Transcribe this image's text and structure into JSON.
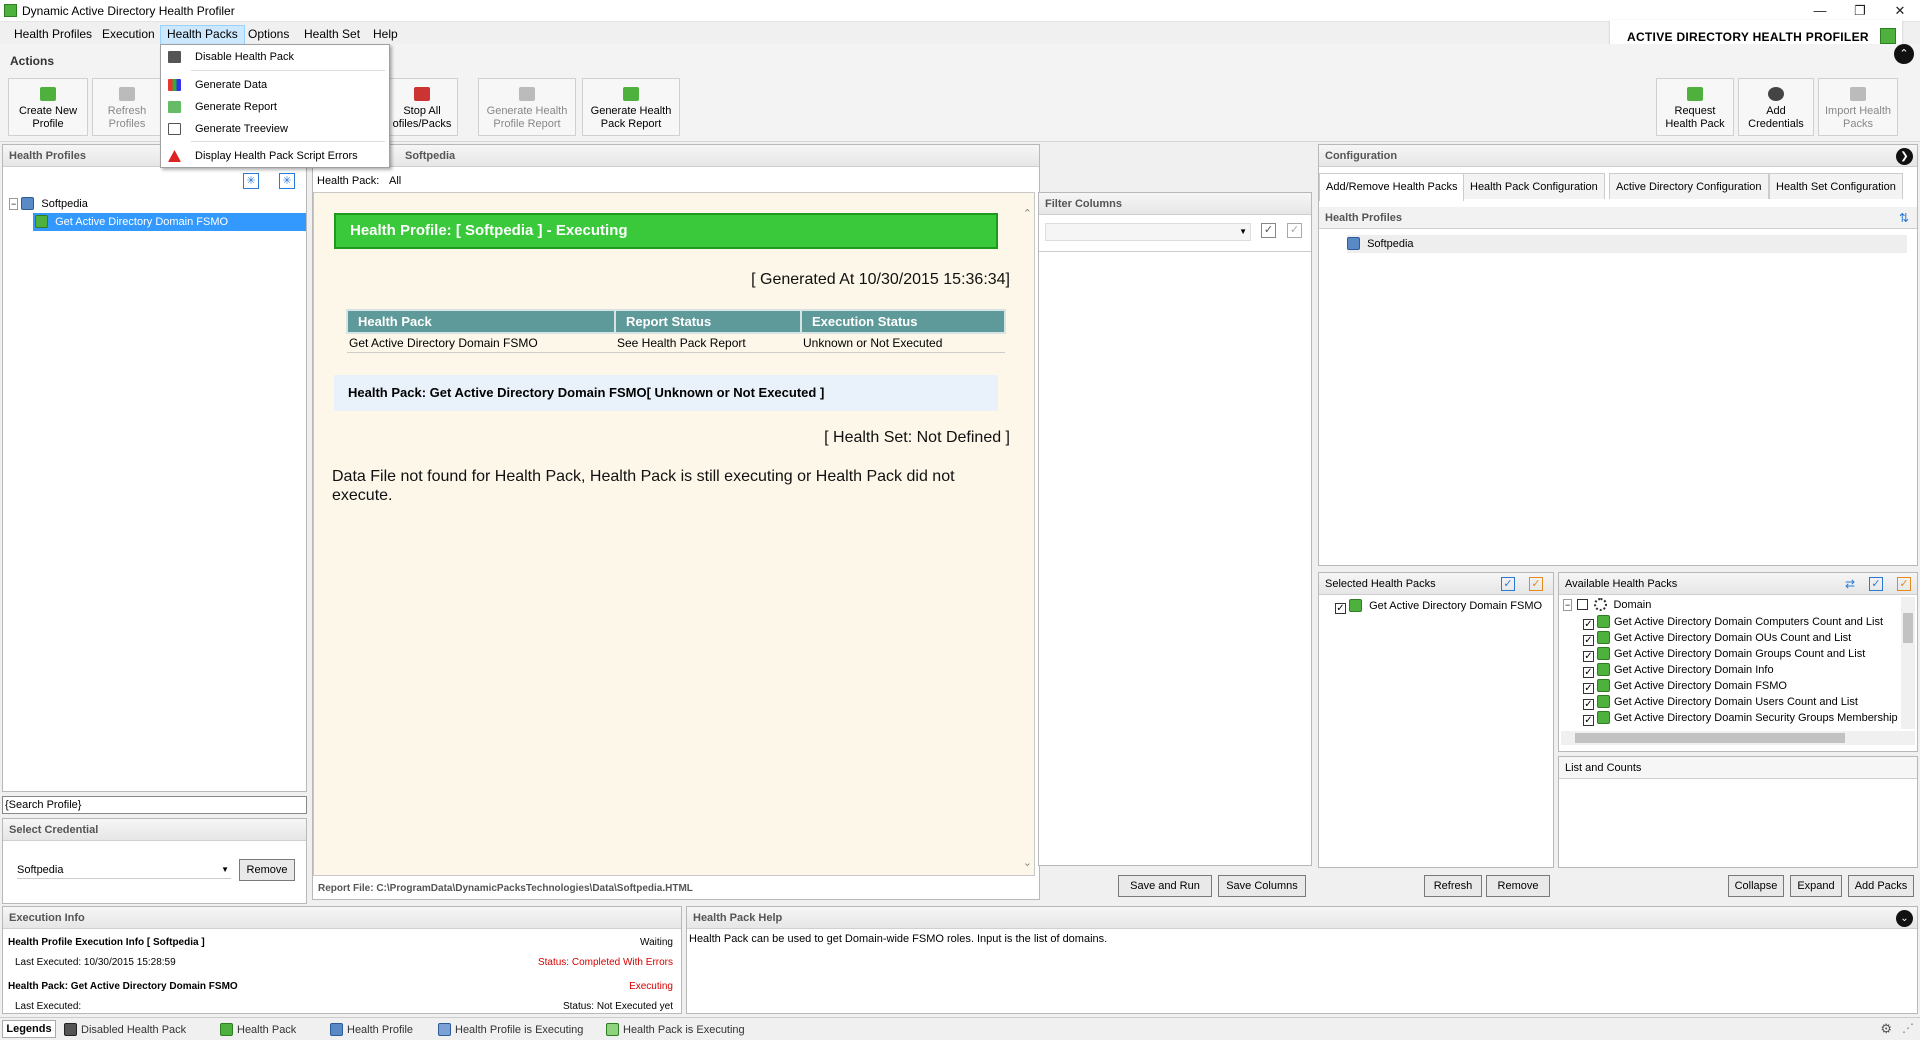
{
  "window": {
    "title": "Dynamic Active Directory Health Profiler",
    "brand": "ACTIVE DIRECTORY HEALTH PROFILER"
  },
  "menu": [
    "Health Profiles",
    "Execution",
    "Health Packs",
    "Options",
    "Health Set",
    "Help"
  ],
  "ribbon": {
    "label": "Actions",
    "left_buttons": [
      {
        "line1": "Create New",
        "line2": "Profile"
      },
      {
        "line1": "Refresh",
        "line2": "Profiles"
      },
      {
        "line1": "Stop All",
        "line2": "ofiles/Packs"
      },
      {
        "line1": "Generate Health",
        "line2": "Profile Report"
      },
      {
        "line1": "Generate Health",
        "line2": "Pack Report"
      }
    ],
    "right_buttons": [
      {
        "line1": "Request",
        "line2": "Health Pack"
      },
      {
        "line1": "Add",
        "line2": "Credentials"
      },
      {
        "line1": "Import Health",
        "line2": "Packs"
      }
    ]
  },
  "dropdown": {
    "items": [
      "Disable Health Pack",
      "Generate Data",
      "Generate Report",
      "Generate Treeview",
      "Display Health Pack Script Errors"
    ]
  },
  "left_panel": {
    "header": "Health Profiles",
    "tree_root": "Softpedia",
    "tree_child": "Get Active Directory Domain FSMO",
    "search_placeholder": "{Search Profile}",
    "credential_header": "Select Credential",
    "credential_value": "Softpedia",
    "remove_label": "Remove"
  },
  "center": {
    "tab_title": "Softpedia",
    "health_pack_label": "Health Pack:",
    "health_pack_value": "All",
    "banner": "Health Profile: [ Softpedia ] - Executing",
    "generated": "[ Generated At 10/30/2015 15:36:34]",
    "table": {
      "headers": [
        "Health Pack",
        "Report Status",
        "Execution Status"
      ],
      "row": [
        "Get Active Directory Domain FSMO",
        "See Health Pack Report",
        "Unknown or Not Executed"
      ]
    },
    "hp_box": "Health Pack: Get Active Directory Domain FSMO[ Unknown or Not Executed ]",
    "health_set": "[ Health Set: Not Defined ]",
    "message": "Data File not found for Health Pack, Health Pack is still executing or Health Pack did not execute.",
    "report_file": "Report File: C:\\ProgramData\\DynamicPacksTechnologies\\Data\\Softpedia.HTML"
  },
  "filter": {
    "header": "Filter Columns",
    "save_run": "Save and Run",
    "save_columns": "Save Columns"
  },
  "config": {
    "header": "Configuration",
    "tabs": [
      "Add/Remove Health Packs",
      "Health Pack Configuration",
      "Active Directory Configuration",
      "Health Set Configuration"
    ],
    "profiles_header": "Health Profiles",
    "profile_item": "Softpedia",
    "selected_header": "Selected Health Packs",
    "selected_item": "Get Active Directory Domain FSMO",
    "available_header": "Available Health Packs",
    "available_root": "Domain",
    "available_items": [
      "Get Active Directory Domain Computers Count and List",
      "Get Active Directory Domain OUs Count and List",
      "Get Active Directory Domain Groups Count and List",
      "Get Active Directory Domain Info",
      "Get Active Directory Domain FSMO",
      "Get Active Directory Domain Users Count and List",
      "Get Active Directory Doamin Security Groups Membership"
    ],
    "list_counts": "List and Counts",
    "refresh": "Refresh",
    "remove": "Remove",
    "collapse": "Collapse",
    "expand": "Expand",
    "add_packs": "Add Packs"
  },
  "exec_info": {
    "header": "Execution Info",
    "profile_line": "Health Profile Execution Info [ Softpedia ]",
    "profile_state": "Waiting",
    "profile_last": "Last Executed: 10/30/2015 15:28:59",
    "profile_status": "Status: Completed With Errors",
    "pack_line": "Health Pack: Get Active Directory Domain FSMO",
    "pack_state": "Executing",
    "pack_last": "Last Executed:",
    "pack_status": "Status: Not Executed yet"
  },
  "help": {
    "header": "Health Pack Help",
    "text": "Health Pack can be used to get Domain-wide FSMO roles. Input is the list of domains."
  },
  "legends": {
    "label": "Legends",
    "items": [
      "Disabled Health Pack",
      "Health Pack",
      "Health Profile",
      "Health Profile is Executing",
      "Health Pack is Executing"
    ]
  },
  "colors": {
    "banner_green": "#3ac93a",
    "table_header": "#5f9a9b",
    "selection_blue": "#3399ff",
    "error_red": "#d40000"
  }
}
